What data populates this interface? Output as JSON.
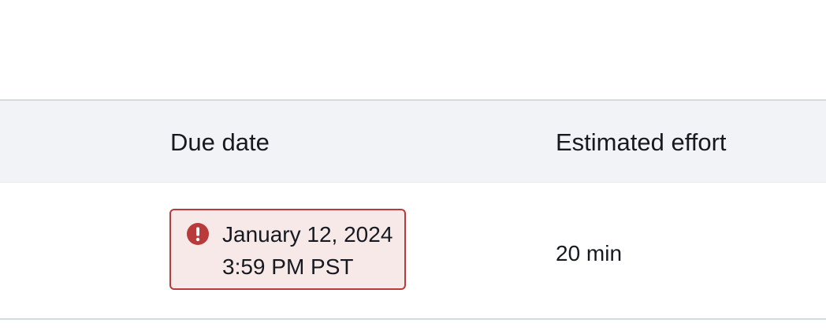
{
  "table": {
    "columns": {
      "due_date": "Due date",
      "estimated_effort": "Estimated effort"
    },
    "rows": [
      {
        "due_date_line1": "January 12, 2024",
        "due_date_line2": "3:59 PM PST",
        "due_status_icon": "exclamation-circle-icon",
        "estimated_effort": "20 min"
      }
    ]
  },
  "colors": {
    "header_background": "#f2f3f7",
    "error_border": "#b83a3a",
    "error_background": "#f8e9e9",
    "error_icon": "#b83a3a",
    "text": "#16191f"
  }
}
